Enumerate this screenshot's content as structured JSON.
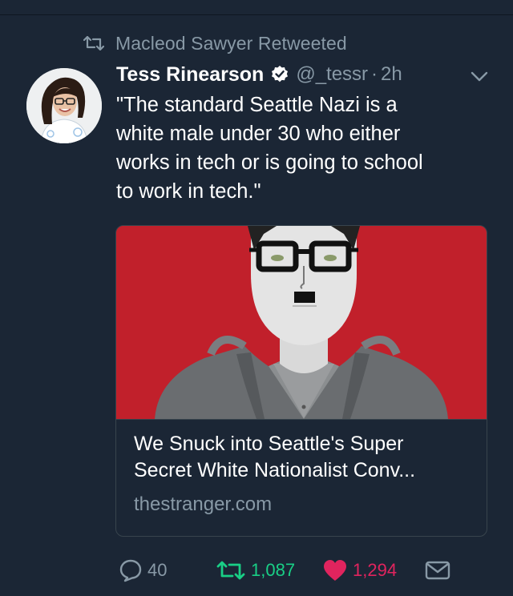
{
  "retweet_context": {
    "text": "Macleod Sawyer Retweeted",
    "icon": "retweet-icon"
  },
  "tweet": {
    "display_name": "Tess Rinearson",
    "verified": true,
    "handle": "@_tessr",
    "separator": "·",
    "time": "2h",
    "text": "\"The standard Seattle Nazi is a\nwhite male under 30 who either\nworks in tech or is going to school\nto work in tech.\"",
    "avatar_icon": "avatar-photo",
    "menu_icon": "chevron-down-icon"
  },
  "card": {
    "title": "We Snuck into Seattle's Super\nSecret White Nationalist Conv...",
    "domain": "thestranger.com",
    "image_background": "#c1202b"
  },
  "actions": {
    "reply_count": "40",
    "retweet_count": "1,087",
    "like_count": "1,294"
  },
  "colors": {
    "background": "#1b2635",
    "secondary_text": "#8899a6",
    "retweet_active": "#19cf86",
    "like_active": "#e0245e"
  }
}
